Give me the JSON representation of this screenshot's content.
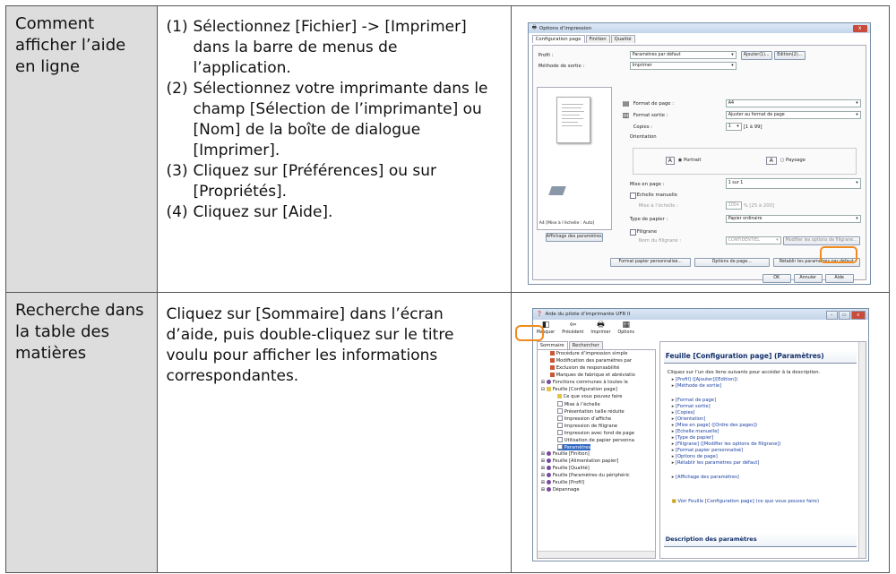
{
  "rows": [
    {
      "label": "Comment afficher l’aide en ligne",
      "steps": [
        {
          "num": "(1)",
          "text": "Sélectionnez [Fichier] -> [Imprimer] dans la barre de menus de l’application."
        },
        {
          "num": "(2)",
          "text": "Sélectionnez votre imprimante dans le champ [Sélection de l’imprimante] ou [Nom] de la boîte de dialogue [Imprimer]."
        },
        {
          "num": "(3)",
          "text": "Cliquez sur [Préférences] ou sur [Propriétés]."
        },
        {
          "num": "(4)",
          "text": "Cliquez sur [Aide]."
        }
      ]
    },
    {
      "label": "Recherche dans la table des matières",
      "text": "Cliquez sur [Sommaire] dans l’écran d’aide, puis double-cliquez sur le titre voulu pour afficher les informations correspondantes."
    }
  ],
  "print_dialog": {
    "title": "Options d’impression",
    "close": "x",
    "tabs": [
      "Configuration page",
      "Finition",
      "Qualité"
    ],
    "profile_label": "Profil :",
    "profile_value": "Paramètres par défaut",
    "add_button": "Ajouter(1)...",
    "edit_button": "Edition(2)...",
    "output_label": "Méthode de sortie :",
    "output_value": "Imprimer",
    "page_format_label": "Format de page :",
    "page_format_value": "A4",
    "output_format_label": "Format sortie :",
    "output_format_value": "Ajuster au format de page",
    "copies_label": "Copies :",
    "copies_value": "1",
    "copies_range": "[1 à 99]",
    "orientation_label": "Orientation",
    "portrait_label": "Portrait",
    "landscape_label": "Paysage",
    "layout_label": "Mise en page :",
    "layout_value": "1 sur 1",
    "manual_scale_label": "Echelle manuelle",
    "scale_label": "Mise à l’échelle :",
    "scale_value": "100",
    "scale_range": "% [25 à 200]",
    "preview_caption": "A4 [Mise à l’échelle : Auto]",
    "show_settings_button": "Affichage des paramètres",
    "paper_type_label": "Type de papier :",
    "paper_type_value": "Papier ordinaire",
    "watermark_label": "Filigrane",
    "watermark_name_label": "Nom du filigrane :",
    "watermark_name_value": "CONFIDENTIEL",
    "modify_watermark_button": "Modifier les options de filigrane...",
    "custom_paper_button": "Format papier personnalisé...",
    "page_options_button": "Options de page...",
    "restore_defaults_button": "Rétablir les paramètres par défaut",
    "ok_button": "OK",
    "cancel_button": "Annuler",
    "help_button": "Aide"
  },
  "help_window": {
    "title": "Aide du pilote d’imprimante UFR II",
    "toolbar": [
      "Masquer",
      "Précédent",
      "Imprimer",
      "Options"
    ],
    "tabs": [
      "Sommaire",
      "Rechercher"
    ],
    "tree": [
      "Procédure d’impression simple",
      "Modification des paramètres par",
      "Exclusion de responsabilité",
      "Marques de fabrique et abréviatio",
      "Fonctions communes à toutes le",
      "Feuille [Configuration page]",
      "Ce que vous pouvez faire",
      "Mise à l’échelle",
      "Présentation taille réduite",
      "Impression d’affiche",
      "Impression de filigrane",
      "Impression avec fond de page",
      "Utilisation de papier personna",
      "Paramètres",
      "Feuille [Finition]",
      "Feuille [Alimentation papier]",
      "Feuille [Qualité]",
      "Feuille [Paramètres du périphéric",
      "Feuille [Profil]",
      "Dépannage"
    ],
    "heading": "Feuille [Configuration page] (Paramètres)",
    "intro": "Cliquez sur l’un des liens suivants pour accéder à la description.",
    "links_group1": [
      "[Profil] ([Ajouter]/[Edition])",
      "[Méthode de sortie]"
    ],
    "links_group2": [
      "[Format de page]",
      "[Format sortie]",
      "[Copies]",
      "[Orientation]",
      "[Mise en page] ([Ordre des pages])",
      "[Echelle manuelle]",
      "[Type de papier]",
      "[Filigrane] ([Modifier les options de filigrane])",
      "[Format papier personnalisé]",
      "[Options de page]",
      "[Rétablir les paramètres par défaut]"
    ],
    "links_group3": [
      "[Affichage des paramètres]"
    ],
    "see_also": "Voir Feuille [Configuration page] (ce que vous pouvez faire)",
    "footer_heading": "Description des paramètres"
  },
  "colors": {
    "highlight": "#f08a1f",
    "label_cell": "#dddddd",
    "link": "#1a3fa0"
  }
}
